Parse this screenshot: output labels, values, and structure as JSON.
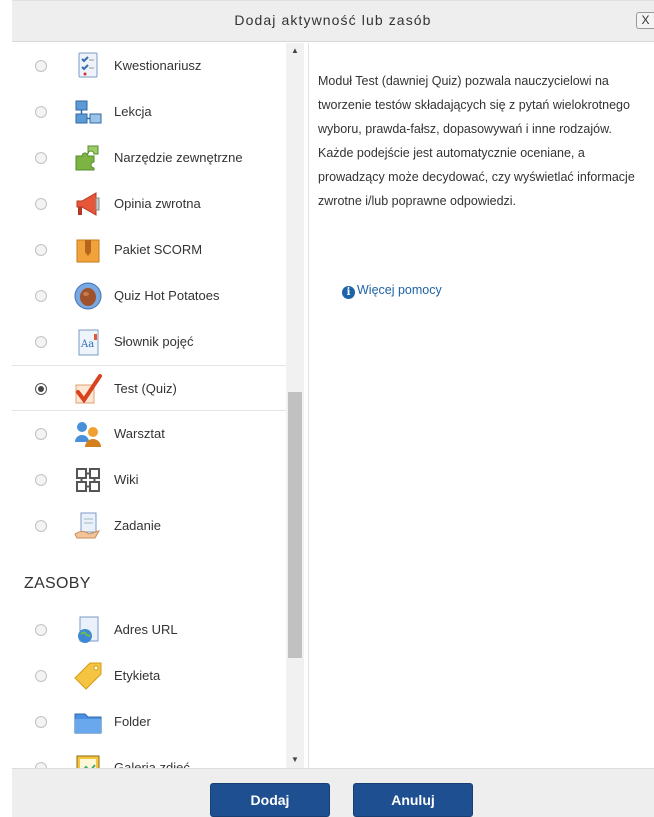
{
  "dialog": {
    "title": "Dodaj aktywność lub zasób",
    "close_label": "X"
  },
  "activities": [
    {
      "label": "Kwestionariusz",
      "icon": "questionnaire-icon"
    },
    {
      "label": "Lekcja",
      "icon": "lesson-icon"
    },
    {
      "label": "Narzędzie zewnętrzne",
      "icon": "puzzle-icon"
    },
    {
      "label": "Opinia zwrotna",
      "icon": "megaphone-icon"
    },
    {
      "label": "Pakiet SCORM",
      "icon": "package-icon"
    },
    {
      "label": "Quiz Hot Potatoes",
      "icon": "hot-potatoes-icon"
    },
    {
      "label": "Słownik pojęć",
      "icon": "glossary-icon"
    },
    {
      "label": "Test (Quiz)",
      "icon": "checkmark-icon",
      "selected": true
    },
    {
      "label": "Warsztat",
      "icon": "workshop-icon"
    },
    {
      "label": "Wiki",
      "icon": "wiki-icon"
    },
    {
      "label": "Zadanie",
      "icon": "assignment-icon"
    }
  ],
  "resources_heading": "ZASOBY",
  "resources": [
    {
      "label": "Adres URL",
      "icon": "globe-icon"
    },
    {
      "label": "Etykieta",
      "icon": "label-tag-icon"
    },
    {
      "label": "Folder",
      "icon": "folder-icon"
    },
    {
      "label": "Galeria zdjęć",
      "icon": "image-gallery-icon"
    }
  ],
  "description": "Moduł Test (dawniej Quiz) pozwala nauczycielowi na tworzenie testów składających się z pytań wielokrotnego wyboru, prawda-fałsz, dopasowywań i inne rodzajów. Każde podejście jest automatycznie oceniane, a prowadzący może decydować, czy wyświetlać informacje zwrotne i/lub poprawne odpowiedzi.",
  "help_link": "Więcej pomocy",
  "buttons": {
    "add": "Dodaj",
    "cancel": "Anuluj"
  },
  "colors": {
    "accent": "#1d4f91",
    "link": "#1d63a8"
  }
}
